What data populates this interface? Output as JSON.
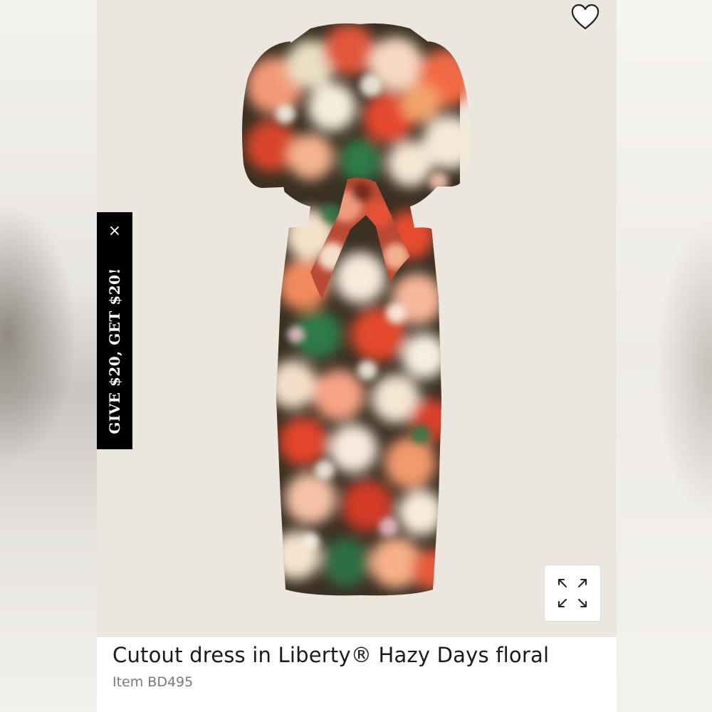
{
  "promo": {
    "text": "GIVE $20, GET $20!",
    "close_label": "×"
  },
  "product": {
    "title": "Cutout dress in Liberty® Hazy Days floral",
    "item": "Item BD495",
    "image_alt": "Cutout dress in Liberty Hazy Days floral"
  },
  "icons": {
    "favorite": "heart-icon",
    "zoom": "expand-icon",
    "close": "close-icon"
  },
  "colors": {
    "image_background": "#ece7de",
    "promo_background": "#000000",
    "title_text": "#1a1a1a",
    "item_text": "#7a7a7a"
  }
}
